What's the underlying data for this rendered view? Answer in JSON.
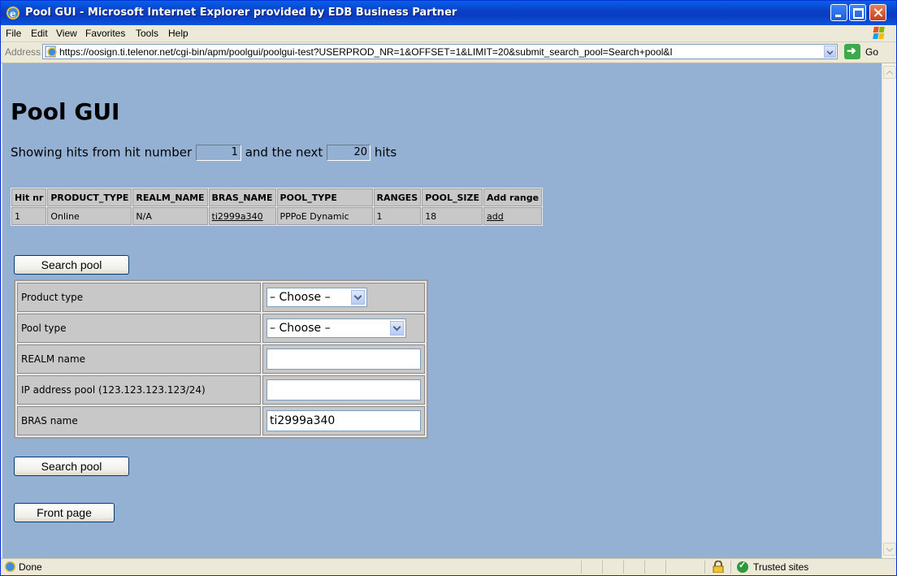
{
  "window": {
    "title": "Pool GUI - Microsoft Internet Explorer provided by EDB Business Partner"
  },
  "menu": {
    "items": [
      "File",
      "Edit",
      "View",
      "Favorites",
      "Tools",
      "Help"
    ]
  },
  "address": {
    "label": "Address",
    "url": "https://oosign.ti.telenor.net/cgi-bin/apm/poolgui/poolgui-test?USERPROD_NR=1&OFFSET=1&LIMIT=20&submit_search_pool=Search+pool&I",
    "go_label": "Go"
  },
  "page": {
    "title": "Pool GUI",
    "hits_prefix": "Showing hits from hit number",
    "offset_value": "1",
    "hits_middle": "and the next",
    "limit_value": "20",
    "hits_suffix": "hits"
  },
  "results": {
    "headers": [
      "Hit nr",
      "PRODUCT_TYPE",
      "REALM_NAME",
      "BRAS_NAME",
      "POOL_TYPE",
      "RANGES",
      "POOL_SIZE",
      "Add range"
    ],
    "rows": [
      [
        "1",
        "Online",
        "N/A",
        "ti2999a340",
        "PPPoE Dynamic",
        "1",
        "18",
        "add"
      ]
    ]
  },
  "form": {
    "search_button": "Search pool",
    "fields": [
      {
        "label": "Product type",
        "type": "select",
        "value": "– Choose –"
      },
      {
        "label": "Pool type",
        "type": "select",
        "value": "– Choose –"
      },
      {
        "label": "REALM name",
        "type": "text",
        "value": ""
      },
      {
        "label": "IP address pool (123.123.123.123/24)",
        "type": "text",
        "value": ""
      },
      {
        "label": "BRAS name",
        "type": "text",
        "value": "ti2999a340"
      }
    ],
    "front_page_button": "Front page"
  },
  "status": {
    "text": "Done",
    "zone": "Trusted sites"
  },
  "colors": {
    "page_background": "#94b1d4",
    "titlebar": "#0a46d0"
  }
}
